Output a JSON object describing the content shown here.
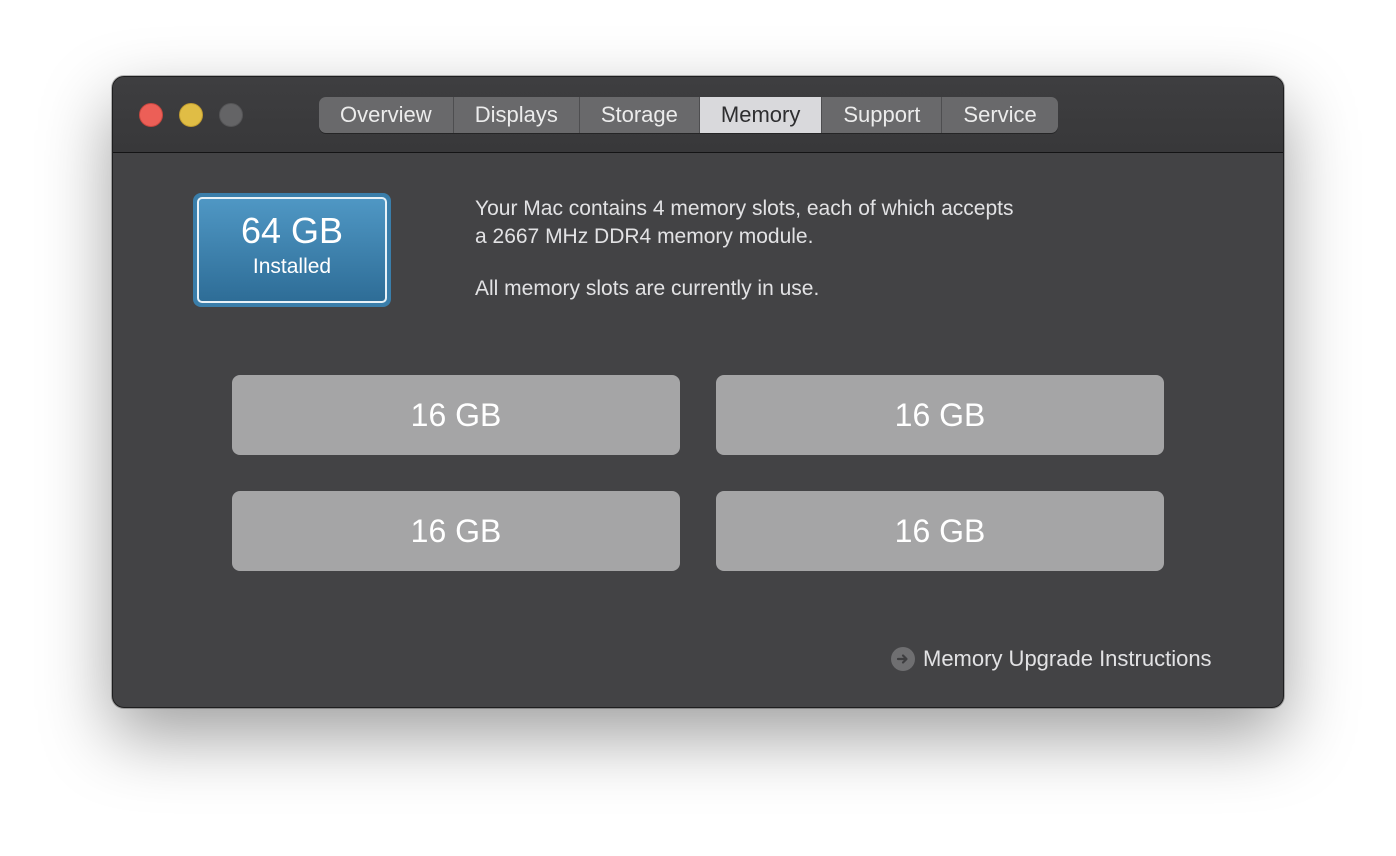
{
  "window": {
    "controls": [
      "close",
      "minimize",
      "zoom"
    ]
  },
  "tabs": [
    {
      "label": "Overview",
      "active": false
    },
    {
      "label": "Displays",
      "active": false
    },
    {
      "label": "Storage",
      "active": false
    },
    {
      "label": "Memory",
      "active": true
    },
    {
      "label": "Support",
      "active": false
    },
    {
      "label": "Service",
      "active": false
    }
  ],
  "memory": {
    "installed_amount": "64 GB",
    "installed_label": "Installed",
    "description_line1": "Your Mac contains 4 memory slots, each of which accepts",
    "description_line2": "a 2667 MHz DDR4 memory module.",
    "status": "All memory slots are currently in use.",
    "slots": [
      "16 GB",
      "16 GB",
      "16 GB",
      "16 GB"
    ],
    "upgrade_link": "Memory Upgrade Instructions"
  },
  "colors": {
    "window_bg": "#434345",
    "installed_accent": "#3a7eaa",
    "slot_bg": "#a5a5a6",
    "close": "#ec5f57",
    "minimize": "#e0bd45",
    "zoom_disabled": "#646466"
  },
  "icons": {
    "upgrade_link_icon": "arrow-right-circle-icon"
  }
}
